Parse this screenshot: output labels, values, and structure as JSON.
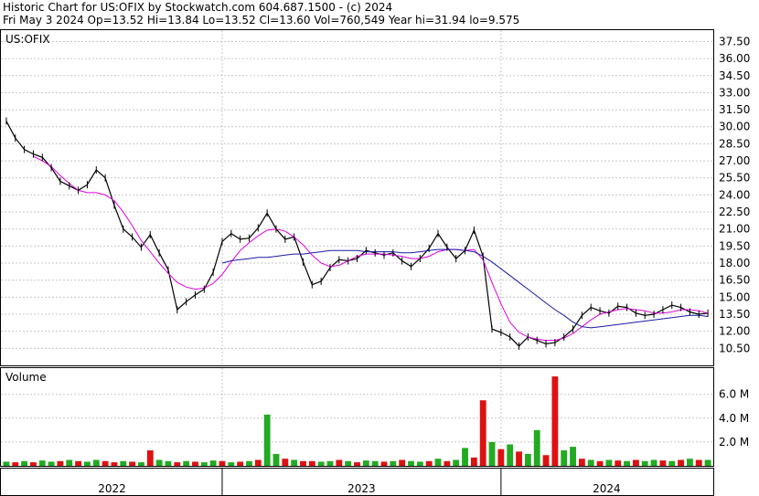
{
  "header": {
    "line1": "Historic Chart for US:OFIX by Stockwatch.com 604.687.1500 - (c) 2024",
    "line2": "Fri May  3 2024   Op=13.52  Hi=13.84  Lo=13.52  Cl=13.60  Vol=760,549  Year hi=31.94  lo=9.575"
  },
  "colors": {
    "price": "#000000",
    "ma_short": "#e000e0",
    "ma_long": "#1a1aa6",
    "vol_up": "#22aa22",
    "vol_down": "#dd1111"
  },
  "chart_data": [
    {
      "type": "line",
      "title": "US:OFIX",
      "ylim": [
        9.0,
        38.5
      ],
      "y_ticks": [
        "37.50",
        "36.00",
        "34.50",
        "33.00",
        "31.50",
        "30.00",
        "28.50",
        "27.00",
        "25.50",
        "24.00",
        "22.50",
        "21.00",
        "19.50",
        "18.00",
        "16.50",
        "15.00",
        "13.50",
        "12.00",
        "10.50"
      ],
      "x_ticks": [
        "2022",
        "2023",
        "2024"
      ],
      "grid": true,
      "series": [
        {
          "key": "price",
          "values": [
            30.5,
            29.0,
            28.0,
            27.6,
            27.3,
            26.4,
            25.2,
            24.8,
            24.4,
            24.9,
            26.2,
            25.5,
            23.1,
            21.0,
            20.3,
            19.4,
            20.5,
            18.9,
            17.4,
            13.9,
            14.6,
            15.2,
            15.7,
            17.2,
            19.9,
            20.6,
            20.1,
            20.2,
            21.1,
            22.4,
            21.0,
            20.1,
            20.3,
            18.1,
            16.1,
            16.4,
            17.6,
            18.3,
            18.2,
            18.4,
            19.1,
            18.9,
            18.7,
            18.9,
            18.2,
            17.7,
            18.4,
            19.3,
            20.6,
            19.4,
            18.4,
            19.1,
            20.9,
            18.6,
            12.2,
            11.9,
            11.5,
            10.7,
            11.5,
            11.2,
            10.9,
            11.0,
            11.5,
            12.2,
            13.4,
            14.1,
            13.8,
            13.6,
            14.2,
            14.1,
            13.6,
            13.4,
            13.5,
            13.9,
            14.3,
            14.1,
            13.7,
            13.5,
            13.6
          ]
        },
        {
          "key": "ma_short",
          "values": [
            null,
            null,
            null,
            27.4,
            27.0,
            26.5,
            25.7,
            25.0,
            24.4,
            24.2,
            24.2,
            24.0,
            23.5,
            22.5,
            21.3,
            20.0,
            19.0,
            18.0,
            17.1,
            16.3,
            15.9,
            15.7,
            15.8,
            16.2,
            17.0,
            18.1,
            19.1,
            19.8,
            20.4,
            20.9,
            21.0,
            20.8,
            20.3,
            19.6,
            18.7,
            18.0,
            17.7,
            17.8,
            18.2,
            18.6,
            18.8,
            18.8,
            18.8,
            18.7,
            18.6,
            18.4,
            18.4,
            18.6,
            19.0,
            19.2,
            19.2,
            19.1,
            19.2,
            18.3,
            16.3,
            14.4,
            12.8,
            11.9,
            11.5,
            11.3,
            11.2,
            11.2,
            11.4,
            11.8,
            12.4,
            13.0,
            13.5,
            13.7,
            13.9,
            14.0,
            13.9,
            13.8,
            13.6,
            13.6,
            13.7,
            13.9,
            13.9,
            13.8,
            13.6
          ]
        },
        {
          "key": "ma_long",
          "values": [
            null,
            null,
            null,
            null,
            null,
            null,
            null,
            null,
            null,
            null,
            null,
            null,
            null,
            null,
            null,
            null,
            null,
            null,
            null,
            null,
            null,
            null,
            null,
            null,
            18.0,
            18.2,
            18.3,
            18.4,
            18.5,
            18.5,
            18.6,
            18.7,
            18.8,
            18.8,
            18.9,
            19.0,
            19.1,
            19.1,
            19.1,
            19.1,
            19.0,
            19.0,
            19.0,
            19.0,
            18.9,
            18.9,
            19.0,
            19.1,
            19.2,
            19.2,
            19.2,
            19.1,
            19.0,
            18.6,
            18.1,
            17.5,
            16.9,
            16.3,
            15.7,
            15.1,
            14.5,
            13.9,
            13.4,
            12.8,
            12.4,
            12.3,
            12.4,
            12.5,
            12.6,
            12.7,
            12.8,
            12.9,
            13.0,
            13.1,
            13.2,
            13.3,
            13.4,
            13.4,
            13.3
          ]
        }
      ]
    },
    {
      "type": "bar",
      "title": "Volume",
      "ylim": [
        0,
        8.2
      ],
      "y_ticks": [
        "6.0 M",
        "4.0 M",
        "2.0 M"
      ],
      "x_ticks": [
        "2022",
        "2023",
        "2024"
      ],
      "grid": true,
      "series": [
        {
          "key": "volume_millions",
          "values": [
            0.35,
            0.3,
            0.4,
            0.3,
            0.45,
            0.35,
            0.4,
            0.5,
            0.4,
            0.35,
            0.5,
            0.4,
            0.3,
            0.4,
            0.35,
            0.3,
            1.3,
            0.5,
            0.4,
            0.3,
            0.4,
            0.35,
            0.3,
            0.45,
            0.4,
            0.3,
            0.35,
            0.4,
            0.5,
            4.3,
            1.0,
            0.6,
            0.5,
            0.4,
            0.4,
            0.35,
            0.4,
            0.5,
            0.4,
            0.3,
            0.45,
            0.4,
            0.35,
            0.4,
            0.5,
            0.4,
            0.35,
            0.4,
            0.6,
            0.4,
            0.5,
            1.5,
            0.7,
            5.5,
            2.0,
            1.4,
            1.8,
            1.2,
            1.0,
            3.0,
            0.9,
            7.5,
            1.3,
            1.6,
            0.6,
            0.5,
            0.4,
            0.5,
            0.45,
            0.4,
            0.5,
            0.4,
            0.5,
            0.45,
            0.4,
            0.5,
            0.6,
            0.5,
            0.5
          ],
          "up": [
            true,
            false,
            true,
            false,
            true,
            true,
            false,
            true,
            false,
            true,
            true,
            false,
            false,
            true,
            false,
            true,
            false,
            true,
            true,
            false,
            true,
            false,
            true,
            true,
            false,
            true,
            false,
            true,
            false,
            true,
            true,
            false,
            true,
            false,
            false,
            true,
            true,
            false,
            true,
            false,
            true,
            true,
            false,
            true,
            false,
            true,
            true,
            false,
            true,
            false,
            true,
            true,
            false,
            false,
            true,
            false,
            true,
            false,
            true,
            true,
            false,
            false,
            true,
            true,
            false,
            true,
            false,
            true,
            false,
            true,
            false,
            true,
            true,
            false,
            true,
            false,
            true,
            false,
            true
          ]
        }
      ]
    }
  ]
}
